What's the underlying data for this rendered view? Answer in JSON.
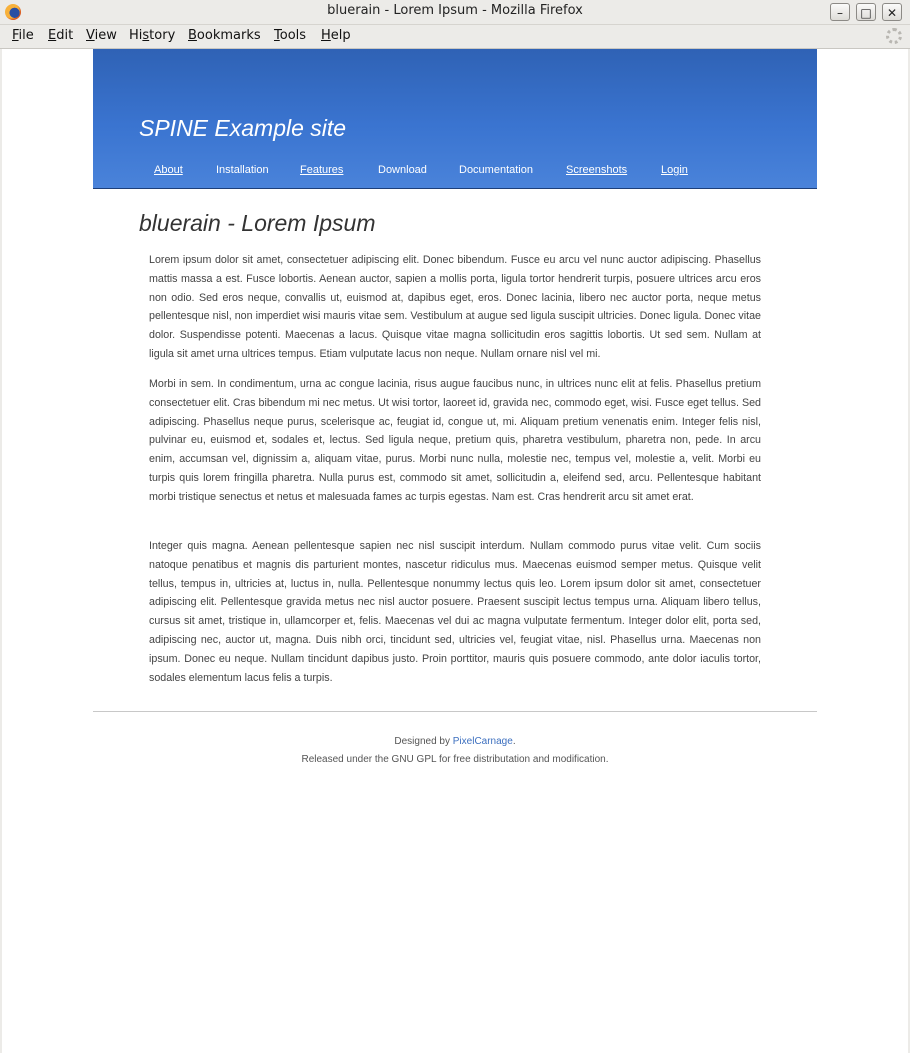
{
  "window": {
    "title": "bluerain - Lorem Ipsum - Mozilla Firefox",
    "buttons": {
      "minimize": "–",
      "maximize": "□",
      "close": "✕"
    }
  },
  "menubar": {
    "items": [
      {
        "key": "F",
        "rest": "ile"
      },
      {
        "key": "E",
        "rest": "dit"
      },
      {
        "key": "V",
        "rest": "iew"
      },
      {
        "pre": "Hi",
        "key": "s",
        "rest": "tory"
      },
      {
        "key": "B",
        "rest": "ookmarks"
      },
      {
        "key": "T",
        "rest": "ools"
      },
      {
        "key": "H",
        "rest": "elp"
      }
    ]
  },
  "site": {
    "title": "SPINE Example site",
    "nav": [
      "About",
      "Installation",
      "Features",
      "Download",
      "Documentation",
      "Screenshots",
      "Login"
    ]
  },
  "content": {
    "heading": "bluerain - Lorem Ipsum",
    "paragraphs": [
      "Lorem ipsum dolor sit amet, consectetuer adipiscing elit. Donec bibendum. Fusce eu arcu vel nunc auctor adipiscing. Phasellus mattis massa a est. Fusce lobortis. Aenean auctor, sapien a mollis porta, ligula tortor hendrerit turpis, posuere ultrices arcu eros non odio. Sed eros neque, convallis ut, euismod at, dapibus eget, eros. Donec lacinia, libero nec auctor porta, neque metus pellentesque nisl, non imperdiet wisi mauris vitae sem. Vestibulum at augue sed ligula suscipit ultricies. Donec ligula. Donec vitae dolor. Suspendisse potenti. Maecenas a lacus. Quisque vitae magna sollicitudin eros sagittis lobortis. Ut sed sem. Nullam at ligula sit amet urna ultrices tempus. Etiam vulputate lacus non neque. Nullam ornare nisl vel mi.",
      "Morbi in sem. In condimentum, urna ac congue lacinia, risus augue faucibus nunc, in ultrices nunc elit at felis. Phasellus pretium consectetuer elit. Cras bibendum mi nec metus. Ut wisi tortor, laoreet id, gravida nec, commodo eget, wisi. Fusce eget tellus. Sed adipiscing. Phasellus neque purus, scelerisque ac, feugiat id, congue ut, mi. Aliquam pretium venenatis enim. Integer felis nisl, pulvinar eu, euismod et, sodales et, lectus. Sed ligula neque, pretium quis, pharetra vestibulum, pharetra non, pede. In arcu enim, accumsan vel, dignissim a, aliquam vitae, purus. Morbi nunc nulla, molestie nec, tempus vel, molestie a, velit. Morbi eu turpis quis lorem fringilla pharetra. Nulla purus est, commodo sit amet, sollicitudin a, eleifend sed, arcu. Pellentesque habitant morbi tristique senectus et netus et malesuada fames ac turpis egestas. Nam est. Cras hendrerit arcu sit amet erat.",
      "Integer quis magna. Aenean pellentesque sapien nec nisl suscipit interdum. Nullam commodo purus vitae velit. Cum sociis natoque penatibus et magnis dis parturient montes, nascetur ridiculus mus. Maecenas euismod semper metus. Quisque velit tellus, tempus in, ultricies at, luctus in, nulla. Pellentesque nonummy lectus quis leo. Lorem ipsum dolor sit amet, consectetuer adipiscing elit. Pellentesque gravida metus nec nisl auctor posuere. Praesent suscipit lectus tempus urna. Aliquam libero tellus, cursus sit amet, tristique in, ullamcorper et, felis. Maecenas vel dui ac magna vulputate fermentum. Integer dolor elit, porta sed, adipiscing nec, auctor ut, magna. Duis nibh orci, tincidunt sed, ultricies vel, feugiat vitae, nisl. Phasellus urna. Maecenas non ipsum. Donec eu neque. Nullam tincidunt dapibus justo. Proin porttitor, mauris quis posuere commodo, ante dolor iaculis tortor, sodales elementum lacus felis a turpis."
    ]
  },
  "footer": {
    "designed_by_prefix": "Designed by ",
    "designer_link": "PixelCarnage",
    "designed_by_suffix": ".",
    "license": "Released under the GNU GPL for free distributation and modification."
  }
}
